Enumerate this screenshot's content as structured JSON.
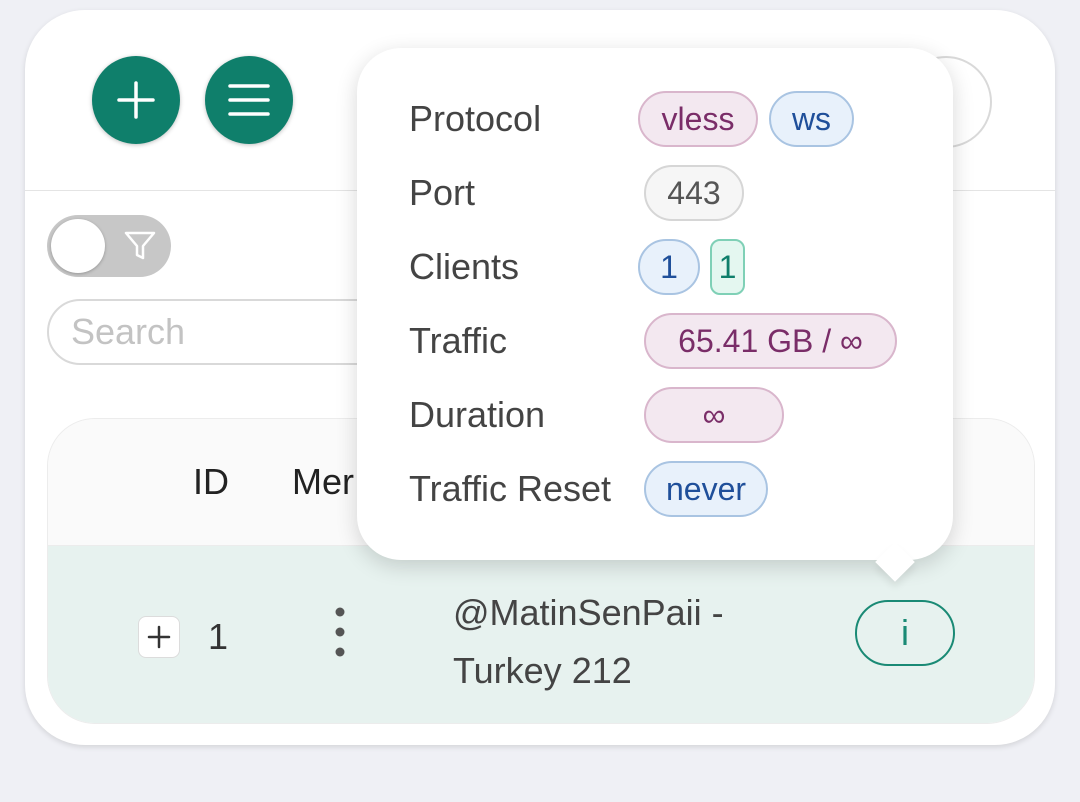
{
  "header": {
    "add_icon": "plus-icon",
    "menu_icon": "hamburger-icon"
  },
  "filter": {
    "toggle_icon": "filter-icon"
  },
  "search": {
    "placeholder": "Search"
  },
  "table": {
    "columns": {
      "id": "ID",
      "menu": "Mer"
    },
    "row": {
      "id": "1",
      "remark_line1": "@MatinSenPaii -",
      "remark_line2": "Turkey 212",
      "info_label": "i"
    }
  },
  "popover": {
    "protocol_label": "Protocol",
    "protocol_value": "vless",
    "network_value": "ws",
    "port_label": "Port",
    "port_value": "443",
    "clients_label": "Clients",
    "clients_total": "1",
    "clients_online": "1",
    "traffic_label": "Traffic",
    "traffic_value": "65.41 GB / ∞",
    "duration_label": "Duration",
    "duration_value": "∞",
    "reset_label": "Traffic Reset",
    "reset_value": "never"
  },
  "colors": {
    "primary": "#0f7f6b",
    "row_highlight": "#e7f2ef",
    "tag_purple": "#7a2d68",
    "tag_blue": "#1f4f9a"
  }
}
